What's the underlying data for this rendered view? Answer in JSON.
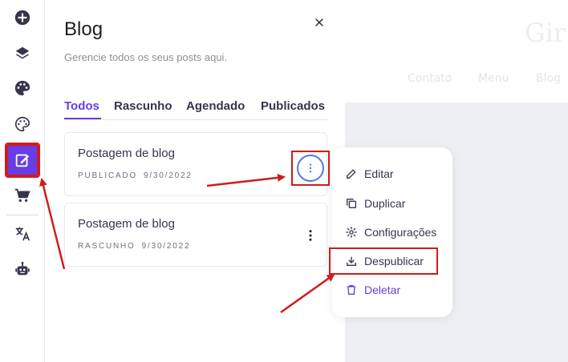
{
  "preview": {
    "brand": "Gir",
    "nav": [
      "Contato",
      "Menu",
      "Blog"
    ]
  },
  "sidebar": {
    "icons": [
      "add-icon",
      "layers-icon",
      "palette-icon",
      "paint-palette-icon",
      "edit-icon",
      "cart-icon",
      "translate-icon",
      "robot-icon"
    ],
    "active": "edit-icon"
  },
  "panel": {
    "title": "Blog",
    "subtitle": "Gerencie todos os seus posts aqui.",
    "tabs": [
      {
        "label": "Todos",
        "active": true
      },
      {
        "label": "Rascunho",
        "active": false
      },
      {
        "label": "Agendado",
        "active": false
      },
      {
        "label": "Publicados",
        "active": false
      }
    ],
    "posts": [
      {
        "title": "Postagem de blog",
        "status": "PUBLICADO",
        "date": "9/30/2022"
      },
      {
        "title": "Postagem de blog",
        "status": "RASCUNHO",
        "date": "9/30/2022"
      }
    ]
  },
  "menu": {
    "items": [
      {
        "label": "Editar",
        "icon": "pencil-icon"
      },
      {
        "label": "Duplicar",
        "icon": "copy-icon"
      },
      {
        "label": "Configurações",
        "icon": "gear-icon"
      },
      {
        "label": "Despublicar",
        "icon": "download-icon"
      },
      {
        "label": "Deletar",
        "icon": "trash-icon"
      }
    ]
  },
  "colors": {
    "accent": "#673de6",
    "annotation": "#d01c1c",
    "ring": "#4d7ed6",
    "text": "#36344d"
  }
}
